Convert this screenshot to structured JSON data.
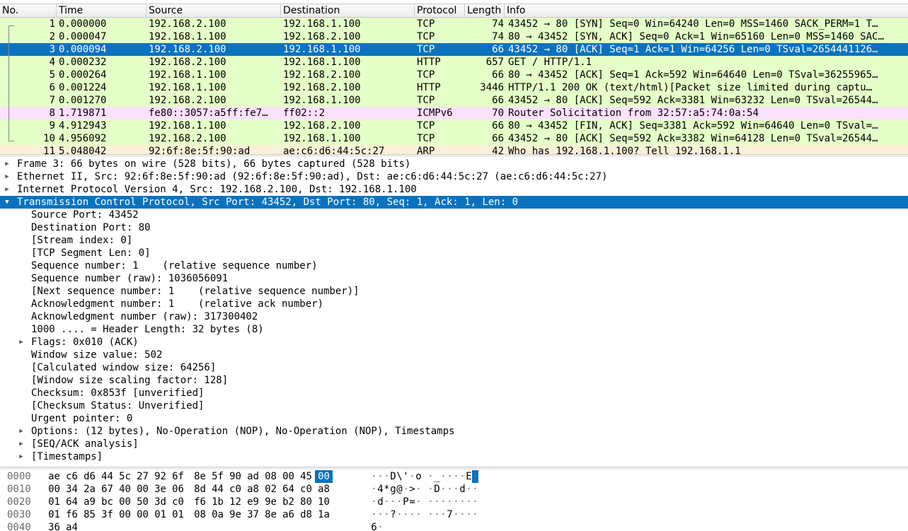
{
  "packet_list": {
    "columns": [
      {
        "label": "No."
      },
      {
        "label": "Time"
      },
      {
        "label": "Source"
      },
      {
        "label": "Destination"
      },
      {
        "label": "Protocol"
      },
      {
        "label": "Length"
      },
      {
        "label": "Info"
      }
    ],
    "rows": [
      {
        "no": "1",
        "time": "0.000000",
        "src": "192.168.2.100",
        "dst": "192.168.1.100",
        "proto": "TCP",
        "len": "74",
        "info": "43452 → 80 [SYN] Seq=0 Win=64240 Len=0 MSS=1460 SACK_PERM=1 T…",
        "color": "tcp"
      },
      {
        "no": "2",
        "time": "0.000047",
        "src": "192.168.1.100",
        "dst": "192.168.2.100",
        "proto": "TCP",
        "len": "74",
        "info": "80 → 43452 [SYN, ACK] Seq=0 Ack=1 Win=65160 Len=0 MSS=1460 SAC…",
        "color": "tcp"
      },
      {
        "no": "3",
        "time": "0.000094",
        "src": "192.168.2.100",
        "dst": "192.168.1.100",
        "proto": "TCP",
        "len": "66",
        "info": "43452 → 80 [ACK] Seq=1 Ack=1 Win=64256 Len=0 TSval=2654441126…",
        "color": "selected"
      },
      {
        "no": "4",
        "time": "0.000232",
        "src": "192.168.2.100",
        "dst": "192.168.1.100",
        "proto": "HTTP",
        "len": "657",
        "info": "GET / HTTP/1.1",
        "color": "http"
      },
      {
        "no": "5",
        "time": "0.000264",
        "src": "192.168.1.100",
        "dst": "192.168.2.100",
        "proto": "TCP",
        "len": "66",
        "info": "80 → 43452 [ACK] Seq=1 Ack=592 Win=64640 Len=0 TSval=36255965…",
        "color": "tcp"
      },
      {
        "no": "6",
        "time": "0.001224",
        "src": "192.168.1.100",
        "dst": "192.168.2.100",
        "proto": "HTTP",
        "len": "3446",
        "info": "HTTP/1.1 200 OK  (text/html)[Packet size limited during captu…",
        "color": "http"
      },
      {
        "no": "7",
        "time": "0.001270",
        "src": "192.168.2.100",
        "dst": "192.168.1.100",
        "proto": "TCP",
        "len": "66",
        "info": "43452 → 80 [ACK] Seq=592 Ack=3381 Win=63232 Len=0 TSval=26544…",
        "color": "tcp"
      },
      {
        "no": "8",
        "time": "1.719871",
        "src": "fe80::3057:a5ff:fe7…",
        "dst": "ff02::2",
        "proto": "ICMPv6",
        "len": "70",
        "info": "Router Solicitation from 32:57:a5:74:0a:54",
        "color": "icmp"
      },
      {
        "no": "9",
        "time": "4.912943",
        "src": "192.168.1.100",
        "dst": "192.168.2.100",
        "proto": "TCP",
        "len": "66",
        "info": "80 → 43452 [FIN, ACK] Seq=3381 Ack=592 Win=64640 Len=0 TSval=…",
        "color": "tcp"
      },
      {
        "no": "10",
        "time": "4.956092",
        "src": "192.168.2.100",
        "dst": "192.168.1.100",
        "proto": "TCP",
        "len": "66",
        "info": "43452 → 80 [ACK] Seq=592 Ack=3382 Win=64128 Len=0 TSval=26544…",
        "color": "tcp"
      },
      {
        "no": "11",
        "time": "5.048042",
        "src": "92:6f:8e:5f:90:ad",
        "dst": "ae:c6:d6:44:5c:27",
        "proto": "ARP",
        "len": "42",
        "info": "Who has 192.168.1.100? Tell 192.168.1.1",
        "color": "arp"
      }
    ]
  },
  "details": [
    {
      "text": "Frame 3: 66 bytes on wire (528 bits), 66 bytes captured (528 bits)",
      "indent": 0,
      "arrow": "collapsed",
      "selected": false
    },
    {
      "text": "Ethernet II, Src: 92:6f:8e:5f:90:ad (92:6f:8e:5f:90:ad), Dst: ae:c6:d6:44:5c:27 (ae:c6:d6:44:5c:27)",
      "indent": 0,
      "arrow": "collapsed",
      "selected": false
    },
    {
      "text": "Internet Protocol Version 4, Src: 192.168.2.100, Dst: 192.168.1.100",
      "indent": 0,
      "arrow": "collapsed",
      "selected": false
    },
    {
      "text": "Transmission Control Protocol, Src Port: 43452, Dst Port: 80, Seq: 1, Ack: 1, Len: 0",
      "indent": 0,
      "arrow": "expanded",
      "selected": true
    },
    {
      "text": "Source Port: 43452",
      "indent": 1,
      "arrow": "none",
      "selected": false
    },
    {
      "text": "Destination Port: 80",
      "indent": 1,
      "arrow": "none",
      "selected": false
    },
    {
      "text": "[Stream index: 0]",
      "indent": 1,
      "arrow": "none",
      "selected": false
    },
    {
      "text": "[TCP Segment Len: 0]",
      "indent": 1,
      "arrow": "none",
      "selected": false
    },
    {
      "text": "Sequence number: 1    (relative sequence number)",
      "indent": 1,
      "arrow": "none",
      "selected": false
    },
    {
      "text": "Sequence number (raw): 1036056091",
      "indent": 1,
      "arrow": "none",
      "selected": false
    },
    {
      "text": "[Next sequence number: 1    (relative sequence number)]",
      "indent": 1,
      "arrow": "none",
      "selected": false
    },
    {
      "text": "Acknowledgment number: 1    (relative ack number)",
      "indent": 1,
      "arrow": "none",
      "selected": false
    },
    {
      "text": "Acknowledgment number (raw): 317300402",
      "indent": 1,
      "arrow": "none",
      "selected": false
    },
    {
      "text": "1000 .... = Header Length: 32 bytes (8)",
      "indent": 1,
      "arrow": "none",
      "selected": false
    },
    {
      "text": "Flags: 0x010 (ACK)",
      "indent": 1,
      "arrow": "collapsed",
      "selected": false
    },
    {
      "text": "Window size value: 502",
      "indent": 1,
      "arrow": "none",
      "selected": false
    },
    {
      "text": "[Calculated window size: 64256]",
      "indent": 1,
      "arrow": "none",
      "selected": false
    },
    {
      "text": "[Window size scaling factor: 128]",
      "indent": 1,
      "arrow": "none",
      "selected": false
    },
    {
      "text": "Checksum: 0x853f [unverified]",
      "indent": 1,
      "arrow": "none",
      "selected": false
    },
    {
      "text": "[Checksum Status: Unverified]",
      "indent": 1,
      "arrow": "none",
      "selected": false
    },
    {
      "text": "Urgent pointer: 0",
      "indent": 1,
      "arrow": "none",
      "selected": false
    },
    {
      "text": "Options: (12 bytes), No-Operation (NOP), No-Operation (NOP), Timestamps",
      "indent": 1,
      "arrow": "collapsed",
      "selected": false
    },
    {
      "text": "[SEQ/ACK analysis]",
      "indent": 1,
      "arrow": "collapsed",
      "selected": false
    },
    {
      "text": "[Timestamps]",
      "indent": 1,
      "arrow": "collapsed",
      "selected": false
    }
  ],
  "bytes": [
    {
      "offset": "0000",
      "hex": [
        "ae",
        "c6",
        "d6",
        "44",
        "5c",
        "27",
        "92",
        "6f",
        "8e",
        "5f",
        "90",
        "ad",
        "08",
        "00",
        "45",
        "00"
      ],
      "ascii": [
        "·",
        "·",
        "·",
        "D",
        "\\",
        "'",
        "·",
        "o",
        "·",
        "_",
        "·",
        "·",
        "·",
        "·",
        "E",
        "·"
      ],
      "highlight": [
        15
      ]
    },
    {
      "offset": "0010",
      "hex": [
        "00",
        "34",
        "2a",
        "67",
        "40",
        "00",
        "3e",
        "06",
        "8d",
        "44",
        "c0",
        "a8",
        "02",
        "64",
        "c0",
        "a8"
      ],
      "ascii": [
        "·",
        "4",
        "*",
        "g",
        "@",
        "·",
        ">",
        "·",
        "·",
        "D",
        "·",
        "·",
        "·",
        "d",
        "·",
        "·"
      ],
      "highlight": []
    },
    {
      "offset": "0020",
      "hex": [
        "01",
        "64",
        "a9",
        "bc",
        "00",
        "50",
        "3d",
        "c0",
        "f6",
        "1b",
        "12",
        "e9",
        "9e",
        "b2",
        "80",
        "10"
      ],
      "ascii": [
        "·",
        "d",
        "·",
        "·",
        "·",
        "P",
        "=",
        "·",
        "·",
        "·",
        "·",
        "·",
        "·",
        "·",
        "·",
        "·"
      ],
      "highlight": []
    },
    {
      "offset": "0030",
      "hex": [
        "01",
        "f6",
        "85",
        "3f",
        "00",
        "00",
        "01",
        "01",
        "08",
        "0a",
        "9e",
        "37",
        "8e",
        "a6",
        "d8",
        "1a"
      ],
      "ascii": [
        "·",
        "·",
        "·",
        "?",
        "·",
        "·",
        "·",
        "·",
        "·",
        "·",
        "·",
        "7",
        "·",
        "·",
        "·",
        "·"
      ],
      "highlight": []
    },
    {
      "offset": "0040",
      "hex": [
        "36",
        "a4"
      ],
      "ascii": [
        "6",
        "·"
      ],
      "highlight": []
    }
  ],
  "colors": {
    "selected": "#0a72be",
    "tcp": "#e4ffc7",
    "http": "#e4ffc7",
    "icmp": "#fce0ff",
    "arp": "#faf0d7"
  }
}
